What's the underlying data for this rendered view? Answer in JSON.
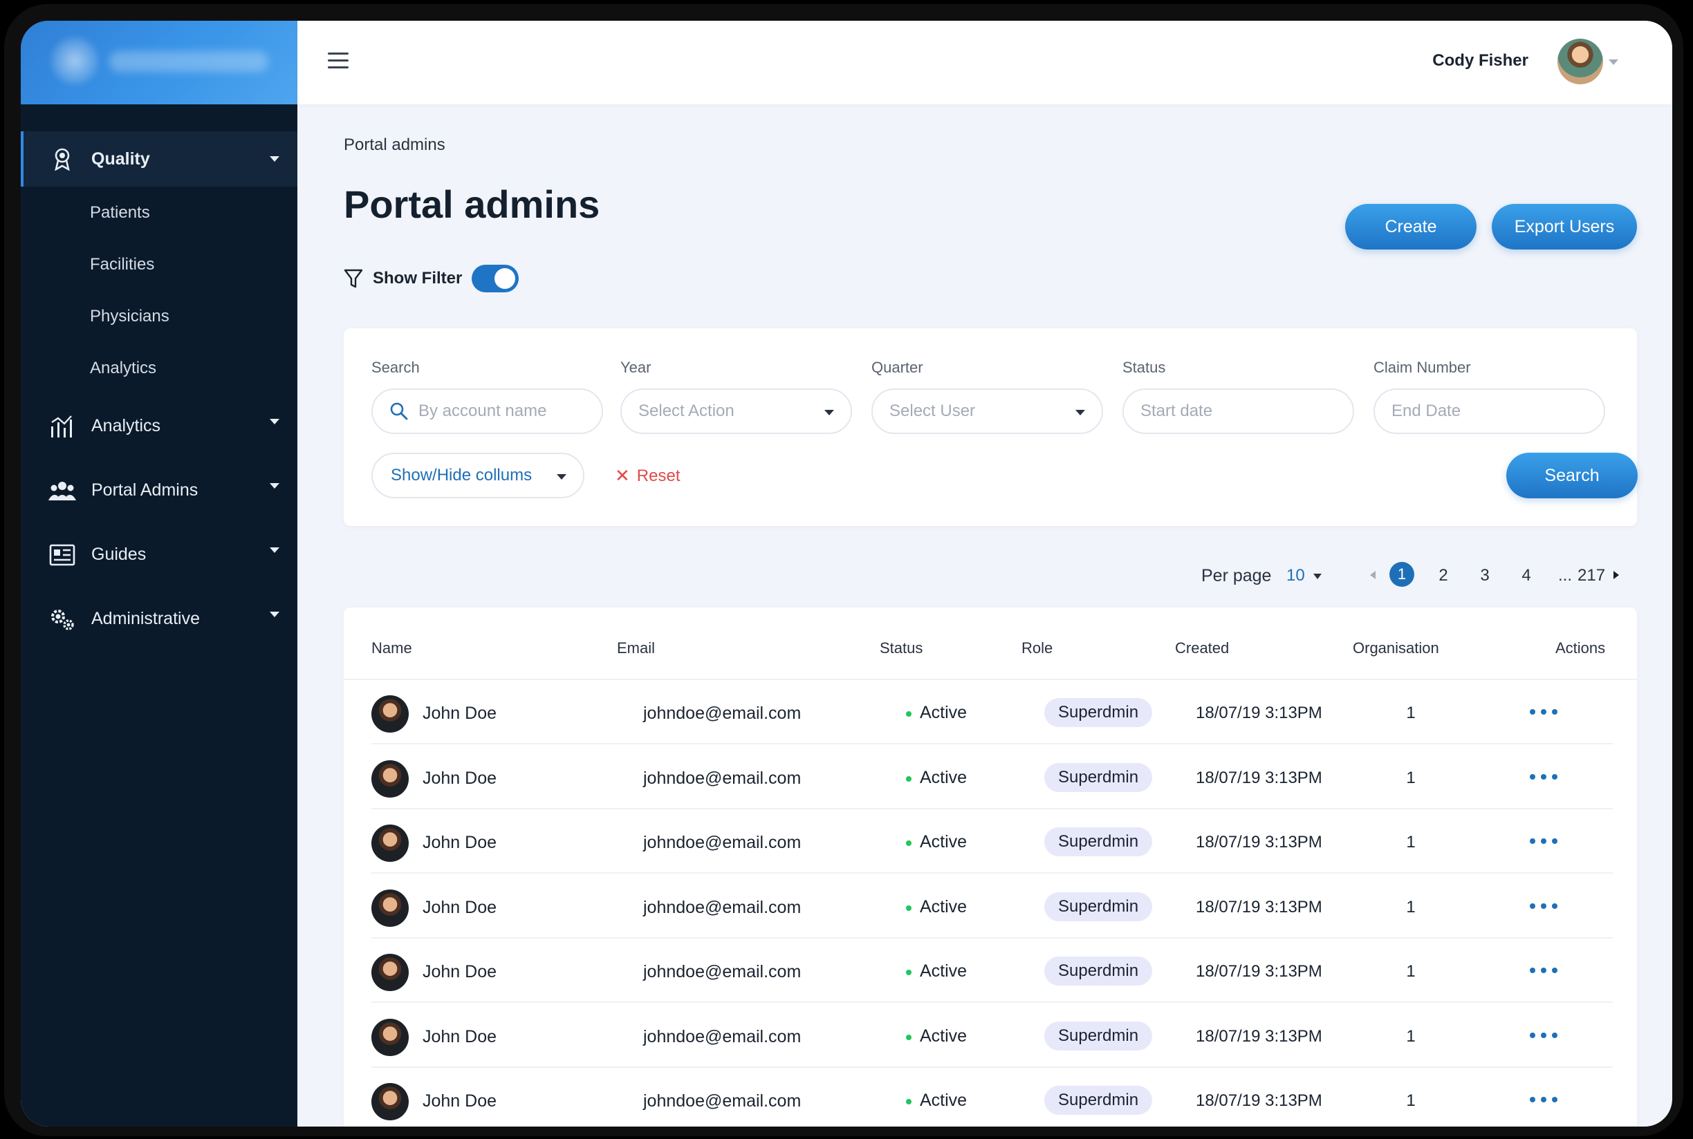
{
  "header": {
    "user_name": "Cody Fisher",
    "avatar_icon": "user-avatar"
  },
  "sidebar": {
    "items": [
      {
        "label": "Quality",
        "icon": "award-icon",
        "active": true,
        "children": [
          "Patients",
          "Facilities",
          "Physicians",
          "Analytics"
        ]
      },
      {
        "label": "Analytics",
        "icon": "bar-chart-icon"
      },
      {
        "label": "Portal Admins",
        "icon": "users-icon"
      },
      {
        "label": "Guides",
        "icon": "guide-icon"
      },
      {
        "label": "Administrative",
        "icon": "gears-icon"
      }
    ]
  },
  "main": {
    "breadcrumb": "Portal admins",
    "title": "Portal admins",
    "create_label": "Create",
    "export_label": "Export Users",
    "show_filter_label": "Show Filter",
    "show_filter_on": true
  },
  "filters": {
    "search": {
      "label": "Search",
      "placeholder": "By account name"
    },
    "year": {
      "label": "Year",
      "placeholder": "Select Action"
    },
    "quarter": {
      "label": "Quarter",
      "placeholder": "Select User"
    },
    "status": {
      "label": "Status",
      "placeholder": "Start date"
    },
    "claim_number": {
      "label": "Claim Number",
      "placeholder": "End Date"
    },
    "columns_label": "Show/Hide collums",
    "reset_label": "Reset",
    "search_button": "Search"
  },
  "pagination": {
    "per_page_label": "Per page",
    "per_page_value": "10",
    "pages": [
      "1",
      "2",
      "3",
      "4",
      "...",
      "217"
    ],
    "current": "1"
  },
  "table": {
    "columns": [
      "Name",
      "Email",
      "Status",
      "Role",
      "Created",
      "Organisation",
      "Actions"
    ],
    "rows": [
      {
        "name": "John Doe",
        "email": "johndoe@email.com",
        "status": "Active",
        "role": "Superdmin",
        "created": "18/07/19 3:13PM",
        "org": "1"
      },
      {
        "name": "John Doe",
        "email": "johndoe@email.com",
        "status": "Active",
        "role": "Superdmin",
        "created": "18/07/19 3:13PM",
        "org": "1"
      },
      {
        "name": "John Doe",
        "email": "johndoe@email.com",
        "status": "Active",
        "role": "Superdmin",
        "created": "18/07/19 3:13PM",
        "org": "1"
      },
      {
        "name": "John Doe",
        "email": "johndoe@email.com",
        "status": "Active",
        "role": "Superdmin",
        "created": "18/07/19 3:13PM",
        "org": "1"
      },
      {
        "name": "John Doe",
        "email": "johndoe@email.com",
        "status": "Active",
        "role": "Superdmin",
        "created": "18/07/19 3:13PM",
        "org": "1"
      },
      {
        "name": "John Doe",
        "email": "johndoe@email.com",
        "status": "Active",
        "role": "Superdmin",
        "created": "18/07/19 3:13PM",
        "org": "1"
      },
      {
        "name": "John Doe",
        "email": "johndoe@email.com",
        "status": "Active",
        "role": "Superdmin",
        "created": "18/07/19 3:13PM",
        "org": "1"
      }
    ]
  },
  "colors": {
    "sidebar_bg": "#0b1a2b",
    "accent": "#1f6fb8",
    "active_dot": "#22c55e",
    "reset": "#e04a4a",
    "role_badge": "#e8e8fb"
  }
}
